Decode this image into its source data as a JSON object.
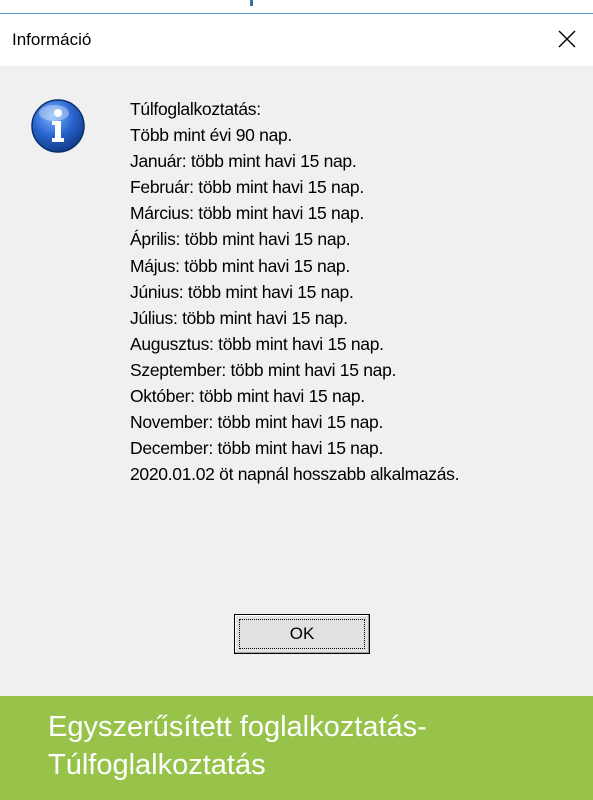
{
  "window": {
    "title": "Információ",
    "close_icon": "close-icon"
  },
  "dialog": {
    "icon": "info-icon",
    "message_lines": [
      "Túlfoglalkoztatás:",
      "Több mint évi 90 nap.",
      "Január: több mint havi 15 nap.",
      "Február: több mint havi 15 nap.",
      "Március: több mint havi 15 nap.",
      "Április: több mint havi 15 nap.",
      "Május: több mint havi 15 nap.",
      "Június: több mint havi 15 nap.",
      "Július: több mint havi 15 nap.",
      "Augusztus: több mint havi 15 nap.",
      "Szeptember: több mint havi 15 nap.",
      "Október: több mint havi 15 nap.",
      "November: több mint havi 15 nap.",
      "December: több mint havi 15 nap.",
      "2020.01.02 öt napnál hosszabb alkalmazás."
    ],
    "ok_label": "OK"
  },
  "caption": {
    "lines": [
      "Egyszerűsített foglalkoztatás-",
      "Túlfoglalkoztatás"
    ]
  },
  "colors": {
    "caption_bg": "#97c34b",
    "dialog_bg": "#f0f0f0",
    "window_border": "#5b9bd5"
  }
}
